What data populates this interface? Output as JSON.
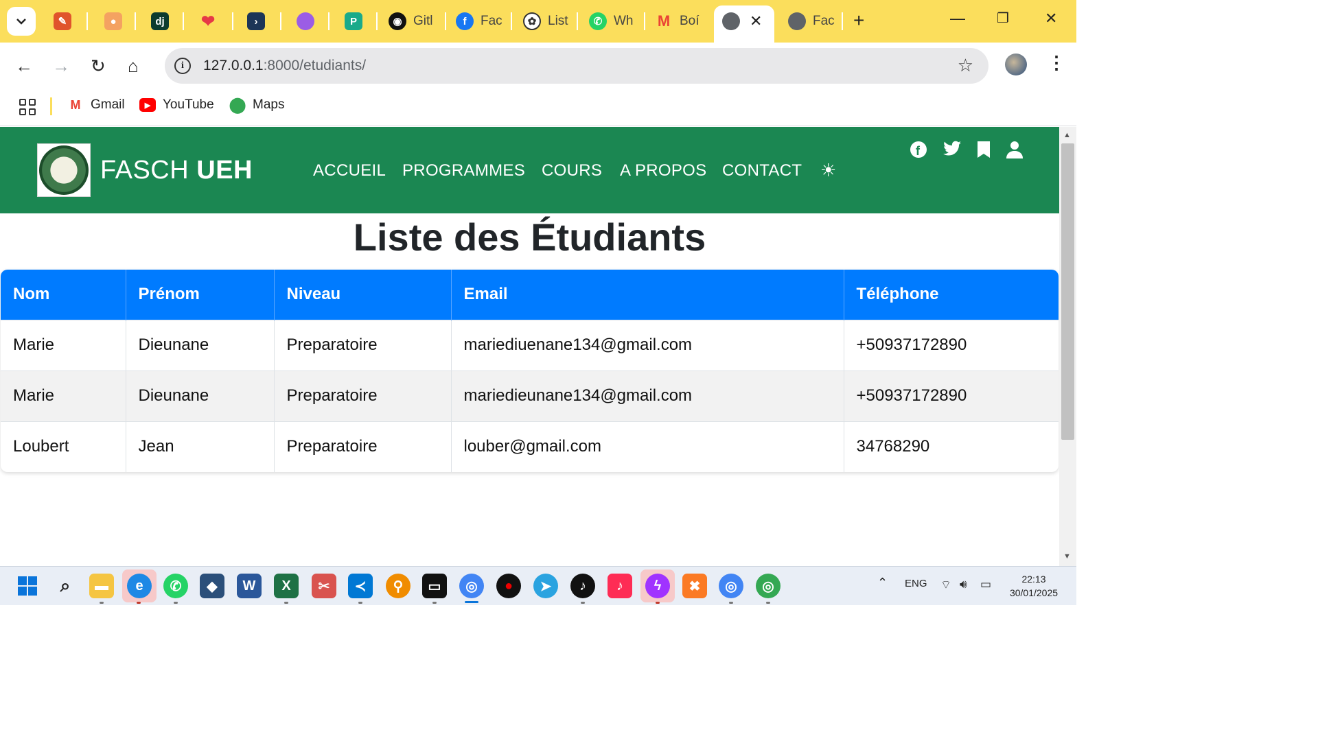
{
  "browser": {
    "tabs": [
      {
        "title": "",
        "icon": "tasks-icon",
        "color": "#e0542c"
      },
      {
        "title": "",
        "icon": "figma-icon",
        "color": "#f4a261"
      },
      {
        "title": "",
        "icon": "django-icon",
        "color": "#0c3b2e",
        "glyph": "dj"
      },
      {
        "title": "",
        "icon": "heart-icon",
        "color": "#e63946"
      },
      {
        "title": "",
        "icon": "code-icon",
        "color": "#1d3557"
      },
      {
        "title": "",
        "icon": "arc-icon",
        "color": "#9b5de5"
      },
      {
        "title": "",
        "icon": "replit-icon",
        "color": "#1aaa8a"
      },
      {
        "title": "Gitl",
        "icon": "github-icon",
        "color": "#111111"
      },
      {
        "title": "Fac",
        "icon": "facebook-icon",
        "color": "#1877f2"
      },
      {
        "title": "List",
        "icon": "chatgpt-icon",
        "color": "#333333"
      },
      {
        "title": "Wh",
        "icon": "whatsapp-icon",
        "color": "#25d366"
      },
      {
        "title": "Boí",
        "icon": "gmail-icon",
        "color": "#ea4335"
      }
    ],
    "active_tab_close": "✕",
    "last_tab_title": "Fac",
    "new_tab": "+",
    "url_host": "127.0.0.1",
    "url_path": ":8000/etudiants/",
    "bookmarks": [
      {
        "label": "Gmail",
        "icon": "gmail-icon"
      },
      {
        "label": "YouTube",
        "icon": "youtube-icon"
      },
      {
        "label": "Maps",
        "icon": "maps-icon"
      }
    ]
  },
  "site": {
    "brand_light": "FASCH",
    "brand_bold": "UEH",
    "nav": [
      "ACCUEIL",
      "PROGRAMMES",
      "COURS",
      "A PROPOS",
      "CONTACT"
    ],
    "social_icons": [
      "facebook-icon",
      "twitter-icon",
      "bookmark-icon",
      "user-icon"
    ]
  },
  "page": {
    "title": "Liste des Étudiants",
    "columns": [
      "Nom",
      "Prénom",
      "Niveau",
      "Email",
      "Téléphone"
    ],
    "rows": [
      [
        "Marie",
        "Dieunane",
        "Preparatoire",
        "mariediuenane134@gmail.com",
        "+50937172890"
      ],
      [
        "Marie",
        "Dieunane",
        "Preparatoire",
        "mariedieunane134@gmail.com",
        "+50937172890"
      ],
      [
        "Loubert",
        "Jean",
        "Preparatoire",
        "louber@gmail.com",
        "34768290"
      ]
    ]
  },
  "taskbar": {
    "language": "ENG",
    "time": "22:13",
    "date": "30/01/2025"
  },
  "colors": {
    "tabstrip": "#fbde5c",
    "header_green": "#1b8752",
    "table_header_blue": "#007bff"
  }
}
